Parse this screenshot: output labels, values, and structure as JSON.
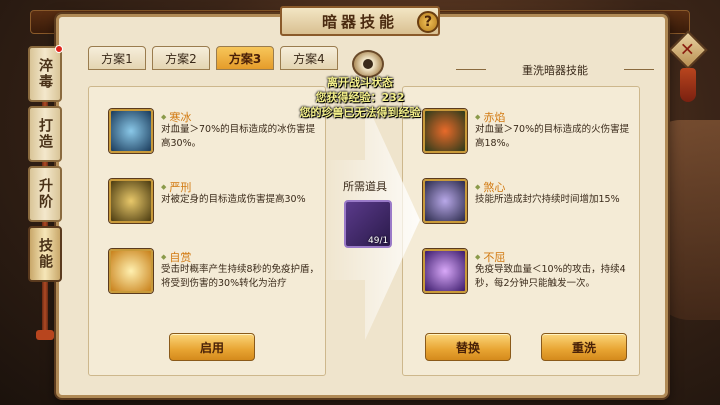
{
  "title": "暗器技能",
  "help_symbol": "?",
  "close_symbol": "✕",
  "side_tabs": [
    {
      "label": "淬毒"
    },
    {
      "label": "打造"
    },
    {
      "label": "升阶"
    },
    {
      "label": "技能"
    }
  ],
  "tabs": [
    {
      "label": "方案1"
    },
    {
      "label": "方案2"
    },
    {
      "label": "方案3"
    },
    {
      "label": "方案4"
    }
  ],
  "reset_title": "重洗暗器技能",
  "notices": [
    "离开战斗状态",
    "您获得经验：232",
    "您的珍兽已无法得到经验"
  ],
  "left_skills": [
    {
      "name": "寒冰",
      "desc": "对血量＞70%的目标造成的冰伤害提高30%。",
      "icon": "ice-skill-icon",
      "color": "#2c6a8a"
    },
    {
      "name": "严刑",
      "desc": "对被定身的目标造成伤害提高30%",
      "icon": "punish-skill-icon",
      "color": "#8a6a1a"
    },
    {
      "name": "自赏",
      "desc": "受击时概率产生持续8秒的免疫护盾，将受到伤害的30%转化为治疗",
      "icon": "self-appreciate-skill-icon",
      "color": "#c88a2a"
    }
  ],
  "right_skills": [
    {
      "name": "赤焰",
      "desc": "对血量＞70%的目标造成的火伤害提高18%。",
      "icon": "fire-skill-icon",
      "color": "#3a6a2a"
    },
    {
      "name": "煞心",
      "desc": "技能所造成封穴持续时间增加15%",
      "icon": "fury-skill-icon",
      "color": "#4a3a6a"
    },
    {
      "name": "不屈",
      "desc": "免疫导致血量＜10%的攻击，持续4秒，每2分钟只能触发一次。",
      "icon": "unyielding-skill-icon",
      "color": "#5a2a8a"
    }
  ],
  "need_label": "所需道具",
  "item_count": "49/1",
  "buttons": {
    "apply": "启用",
    "replace": "替换",
    "rewash": "重洗"
  }
}
